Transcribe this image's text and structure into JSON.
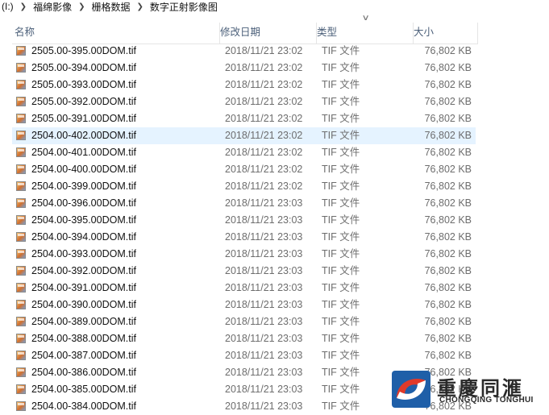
{
  "breadcrumb": {
    "drive": "(I:)",
    "items": [
      "福绵影像",
      "栅格数据",
      "数字正射影像图"
    ]
  },
  "columns": {
    "name": "名称",
    "date": "修改日期",
    "type": "类型",
    "size": "大小"
  },
  "files": [
    {
      "name": "2505.00-395.00DOM.tif",
      "date": "2018/11/21 23:02",
      "type": "TIF 文件",
      "size": "76,802 KB"
    },
    {
      "name": "2505.00-394.00DOM.tif",
      "date": "2018/11/21 23:02",
      "type": "TIF 文件",
      "size": "76,802 KB"
    },
    {
      "name": "2505.00-393.00DOM.tif",
      "date": "2018/11/21 23:02",
      "type": "TIF 文件",
      "size": "76,802 KB"
    },
    {
      "name": "2505.00-392.00DOM.tif",
      "date": "2018/11/21 23:02",
      "type": "TIF 文件",
      "size": "76,802 KB"
    },
    {
      "name": "2505.00-391.00DOM.tif",
      "date": "2018/11/21 23:02",
      "type": "TIF 文件",
      "size": "76,802 KB"
    },
    {
      "name": "2504.00-402.00DOM.tif",
      "date": "2018/11/21 23:02",
      "type": "TIF 文件",
      "size": "76,802 KB",
      "selected": true
    },
    {
      "name": "2504.00-401.00DOM.tif",
      "date": "2018/11/21 23:02",
      "type": "TIF 文件",
      "size": "76,802 KB"
    },
    {
      "name": "2504.00-400.00DOM.tif",
      "date": "2018/11/21 23:02",
      "type": "TIF 文件",
      "size": "76,802 KB"
    },
    {
      "name": "2504.00-399.00DOM.tif",
      "date": "2018/11/21 23:02",
      "type": "TIF 文件",
      "size": "76,802 KB"
    },
    {
      "name": "2504.00-396.00DOM.tif",
      "date": "2018/11/21 23:03",
      "type": "TIF 文件",
      "size": "76,802 KB"
    },
    {
      "name": "2504.00-395.00DOM.tif",
      "date": "2018/11/21 23:03",
      "type": "TIF 文件",
      "size": "76,802 KB"
    },
    {
      "name": "2504.00-394.00DOM.tif",
      "date": "2018/11/21 23:03",
      "type": "TIF 文件",
      "size": "76,802 KB"
    },
    {
      "name": "2504.00-393.00DOM.tif",
      "date": "2018/11/21 23:03",
      "type": "TIF 文件",
      "size": "76,802 KB"
    },
    {
      "name": "2504.00-392.00DOM.tif",
      "date": "2018/11/21 23:03",
      "type": "TIF 文件",
      "size": "76,802 KB"
    },
    {
      "name": "2504.00-391.00DOM.tif",
      "date": "2018/11/21 23:03",
      "type": "TIF 文件",
      "size": "76,802 KB"
    },
    {
      "name": "2504.00-390.00DOM.tif",
      "date": "2018/11/21 23:03",
      "type": "TIF 文件",
      "size": "76,802 KB"
    },
    {
      "name": "2504.00-389.00DOM.tif",
      "date": "2018/11/21 23:03",
      "type": "TIF 文件",
      "size": "76,802 KB"
    },
    {
      "name": "2504.00-388.00DOM.tif",
      "date": "2018/11/21 23:03",
      "type": "TIF 文件",
      "size": "76,802 KB"
    },
    {
      "name": "2504.00-387.00DOM.tif",
      "date": "2018/11/21 23:03",
      "type": "TIF 文件",
      "size": "76,802 KB"
    },
    {
      "name": "2504.00-386.00DOM.tif",
      "date": "2018/11/21 23:03",
      "type": "TIF 文件",
      "size": "76,802 KB"
    },
    {
      "name": "2504.00-385.00DOM.tif",
      "date": "2018/11/21 23:03",
      "type": "TIF 文件",
      "size": "76,802 KB"
    },
    {
      "name": "2504.00-384.00DOM.tif",
      "date": "2018/11/21 23:03",
      "type": "TIF 文件",
      "size": "76,802 KB"
    }
  ],
  "icons": {
    "file": "tif-image-file-icon",
    "separator": "chevron-right-icon",
    "sort": "chevron-down-icon"
  },
  "colors": {
    "header_text": "#4c607a",
    "selected_row": "#e5f3ff",
    "secondary_text": "#6d6d6d"
  },
  "watermark": {
    "cn": "重慶同滙",
    "en": "CHONGQING TONGHUI"
  }
}
